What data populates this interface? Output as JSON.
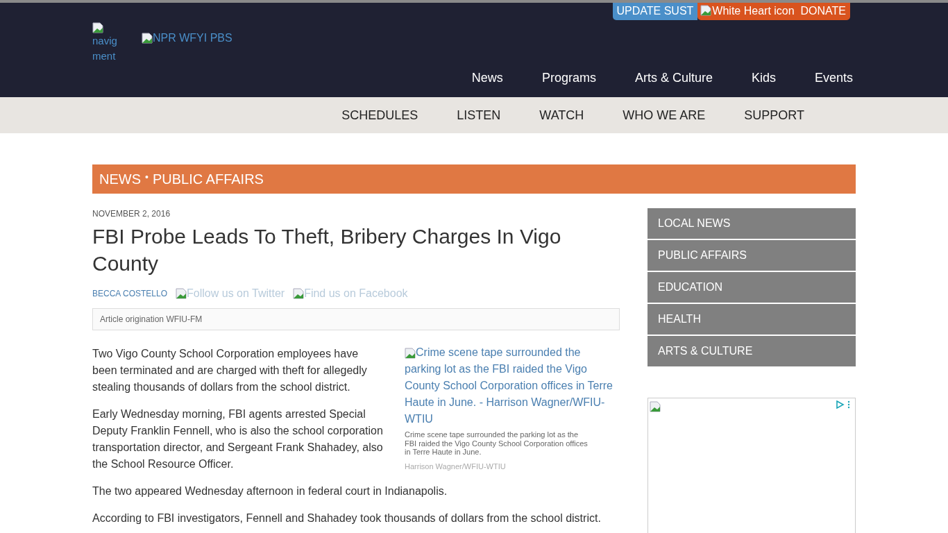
{
  "header": {
    "menu_alt": "navig ment",
    "logo_alt": "NPR WFYI PBS",
    "update_button": "UPDATE SUST",
    "donate_icon_alt": "White Heart icon",
    "donate_button": "DONATE"
  },
  "main_nav": [
    "News",
    "Programs",
    "Arts & Culture",
    "Kids",
    "Events"
  ],
  "sub_nav": [
    "SCHEDULES",
    "LISTEN",
    "WATCH",
    "WHO WE ARE",
    "SUPPORT"
  ],
  "section_banner": {
    "primary": "NEWS",
    "separator": "•",
    "secondary": "PUBLIC AFFAIRS"
  },
  "article": {
    "date": "NOVEMBER 2, 2016",
    "title": "FBI Probe Leads To Theft, Bribery Charges In Vigo County",
    "author": "BECCA COSTELLO",
    "twitter_alt": "Follow us on Twitter",
    "facebook_alt": "Find us on Facebook",
    "origination": "Article origination WFIU-FM",
    "figure": {
      "alt": "Crime scene tape surrounded the parking lot as the FBI raided the Vigo County School Corporation offices in Terre Haute in June. - Harrison Wagner/WFIU-WTIU",
      "caption": "Crime scene tape surrounded the parking lot as the FBI raided the Vigo County School Corporation offices in Terre Haute in June.",
      "credit": "Harrison Wagner/WFIU-WTIU"
    },
    "paragraphs": [
      "Two Vigo County School Corporation employees have been terminated and are charged with theft for allegedly stealing thousands of dollars from the school district.",
      "Early Wednesday morning, FBI agents arrested Special Deputy Franklin Fennell, who is also the school corporation transportation director, and Sergeant Frank Shahadey, also the School Resource Officer.",
      "The two appeared Wednesday afternoon in federal court in Indianapolis.",
      "According to FBI investigators, Fennell and Shahadey took thousands of dollars from the school district."
    ]
  },
  "sidebar": {
    "items": [
      "LOCAL NEWS",
      "PUBLIC AFFAIRS",
      "EDUCATION",
      "HEALTH",
      "ARTS & CULTURE"
    ]
  }
}
